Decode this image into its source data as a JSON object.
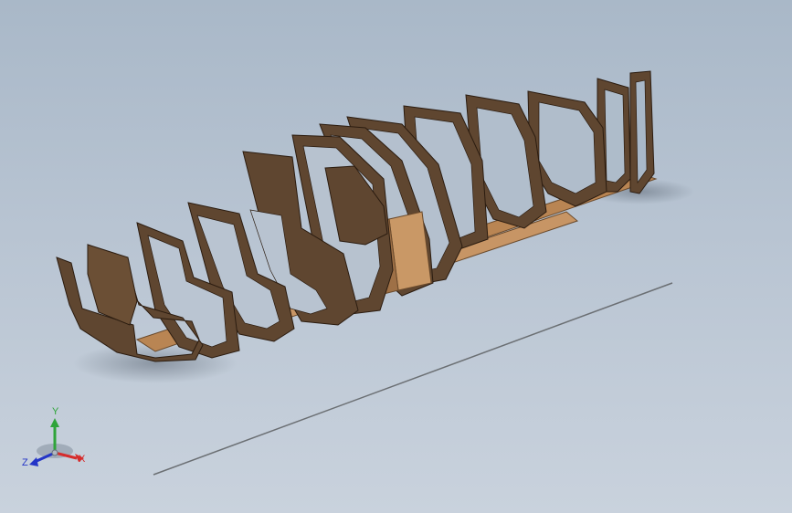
{
  "viewport": {
    "background_top": "#a9b8c8",
    "background_bottom": "#c9d2dd"
  },
  "model": {
    "description_icon": "boat-hull-frame-model",
    "frame_color": "#5f4630",
    "frame_edge_color": "#2b1c10",
    "stringer_color": "#b98553"
  },
  "reference_line": {
    "color": "#6b6f73"
  },
  "triad": {
    "x_label": "X",
    "y_label": "Y",
    "z_label": "Z",
    "x_color": "#d62c2c",
    "y_color": "#2fa43a",
    "z_color": "#2435c7"
  }
}
